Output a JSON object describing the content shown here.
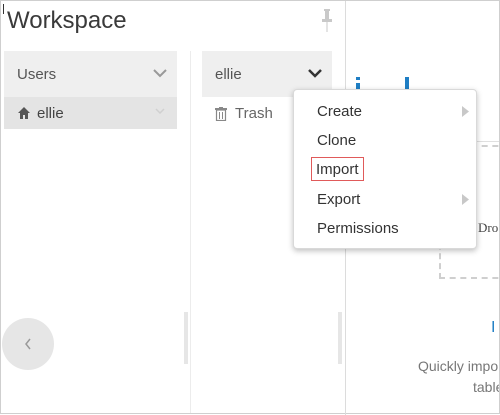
{
  "window": {
    "title": "Workspace"
  },
  "column1": {
    "header": "Users",
    "selected_item": "ellie"
  },
  "column2": {
    "header": "ellie",
    "items": [
      {
        "label": "Trash"
      }
    ]
  },
  "context_menu": {
    "items": [
      {
        "label": "Create",
        "has_submenu": true
      },
      {
        "label": "Clone",
        "has_submenu": false
      },
      {
        "label": "Import",
        "has_submenu": false,
        "highlighted": true
      },
      {
        "label": "Export",
        "has_submenu": true
      },
      {
        "label": "Permissions",
        "has_submenu": false
      }
    ]
  },
  "right_panel": {
    "drop_label": "Dro",
    "blue_link": "I",
    "description_line1": "Quickly impo",
    "description_line2": "table"
  },
  "icons": {
    "pin": "pin-icon",
    "chevron": "chevron-down-icon",
    "home": "home-icon",
    "trash": "trash-icon",
    "back": "chevron-left-icon",
    "submenu": "caret-right-icon"
  },
  "colors": {
    "accent": "#1f7ec4",
    "highlight_outline": "#e05a5a"
  }
}
